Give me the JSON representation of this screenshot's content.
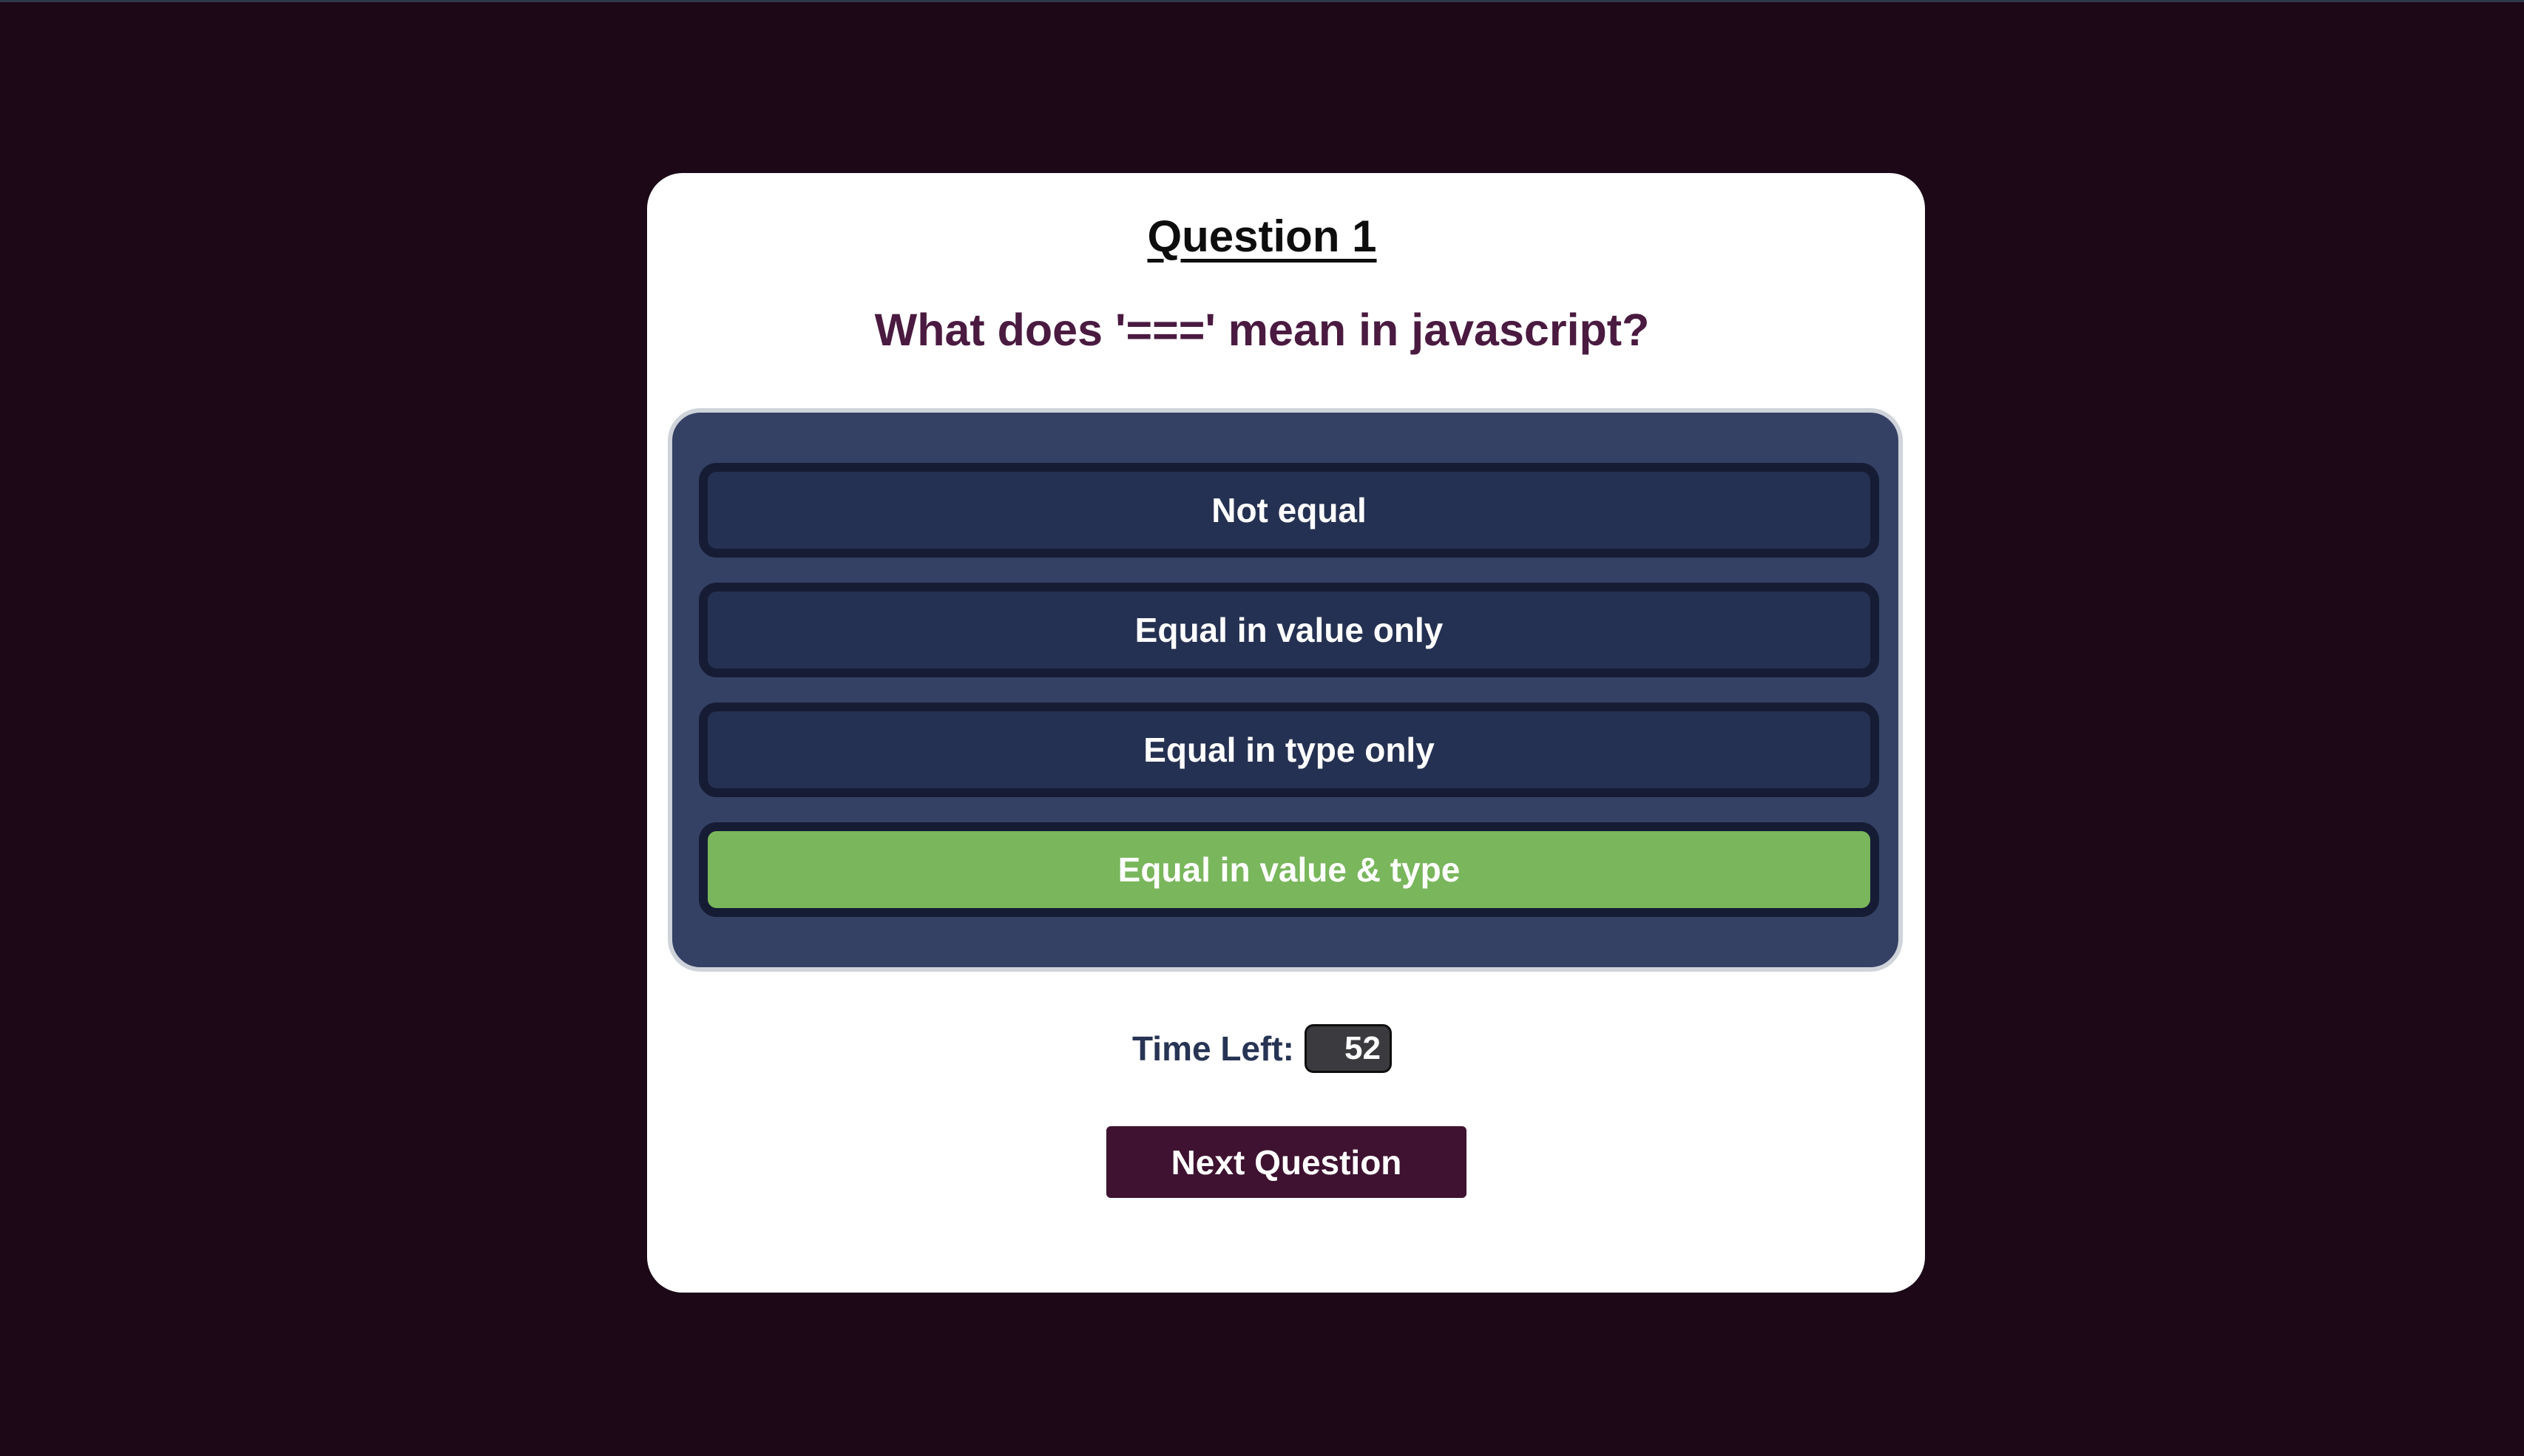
{
  "quiz": {
    "question_number": "Question 1",
    "question_text": "What does '===' mean in javascript?",
    "answers": [
      {
        "label": "Not equal",
        "state": "default"
      },
      {
        "label": "Equal in value only",
        "state": "default"
      },
      {
        "label": "Equal in type only",
        "state": "default"
      },
      {
        "label": "Equal in value & type",
        "state": "correct"
      }
    ],
    "timer": {
      "label": "Time Left:",
      "value": "52"
    },
    "next_button_label": "Next Question"
  },
  "colors": {
    "background": "#1c0816",
    "card": "#ffffff",
    "question_text": "#4a1a40",
    "answers_panel": "#344164",
    "answer_button": "#253152",
    "answer_border": "#161c34",
    "correct_answer": "#79b65c",
    "next_button": "#3e1230",
    "timer_box": "#3b3b3f"
  }
}
